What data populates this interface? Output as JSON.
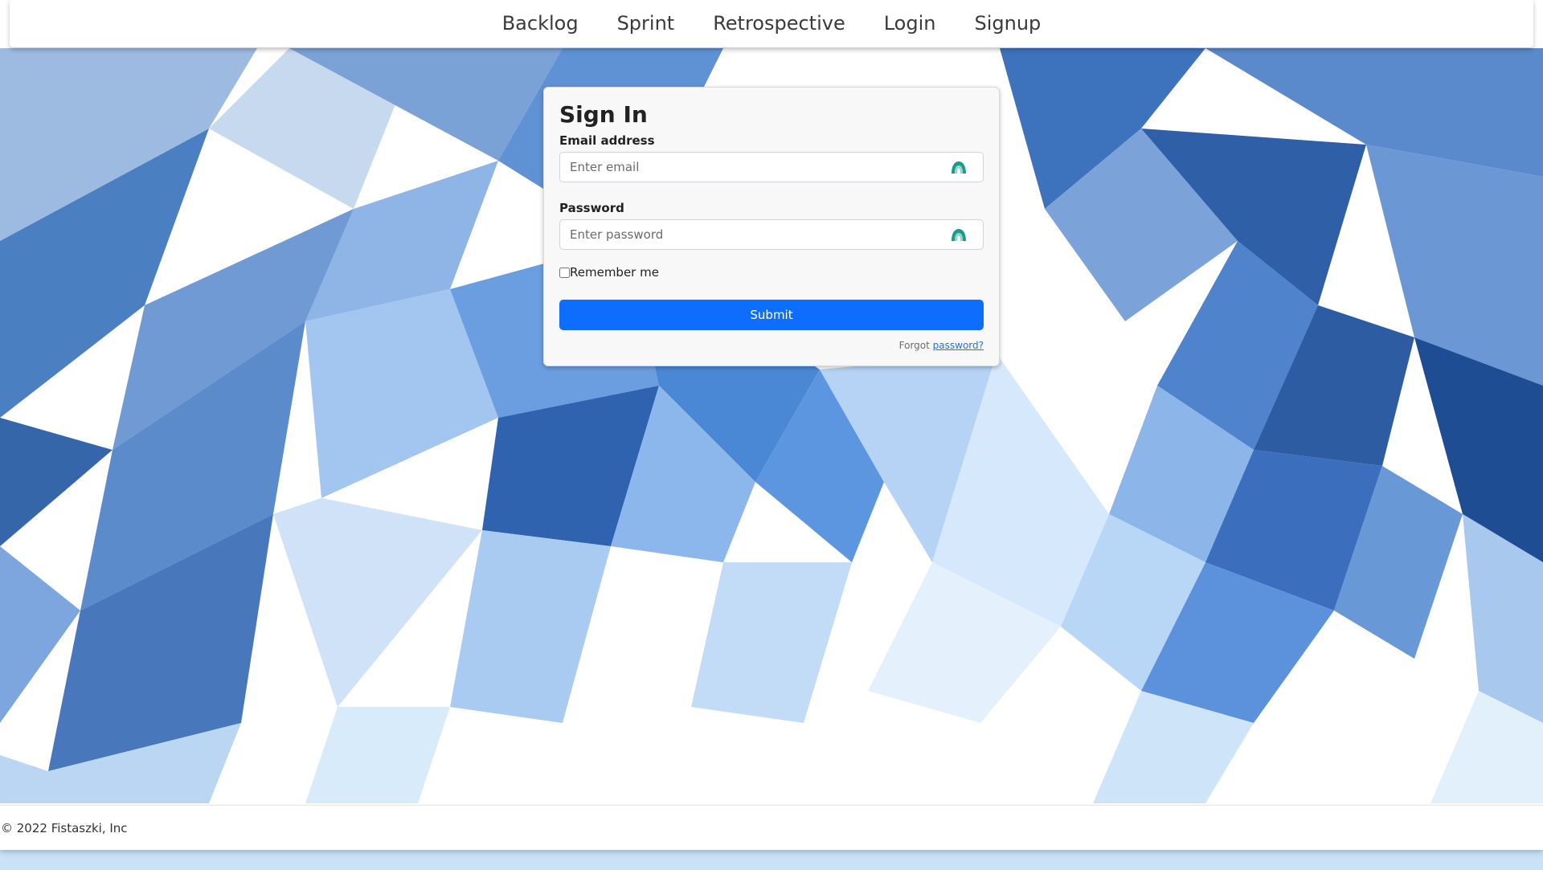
{
  "nav": {
    "items": [
      {
        "label": "Backlog"
      },
      {
        "label": "Sprint"
      },
      {
        "label": "Retrospective"
      },
      {
        "label": "Login"
      },
      {
        "label": "Signup"
      }
    ]
  },
  "signin": {
    "title": "Sign In",
    "email_label": "Email address",
    "email_placeholder": "Enter email",
    "email_value": "",
    "password_label": "Password",
    "password_placeholder": "Enter password",
    "password_value": "",
    "remember_label": "Remember me",
    "remember_checked": false,
    "submit_label": "Submit",
    "forgot_prefix": "Forgot ",
    "forgot_link": "password?"
  },
  "footer": {
    "text": "© 2022 Fistaszki, Inc"
  },
  "colors": {
    "primary": "#0d6efd",
    "icon": "#1a9b8e",
    "link": "#1a73e8"
  },
  "icons": {
    "field_icon": "password-manager-icon"
  }
}
